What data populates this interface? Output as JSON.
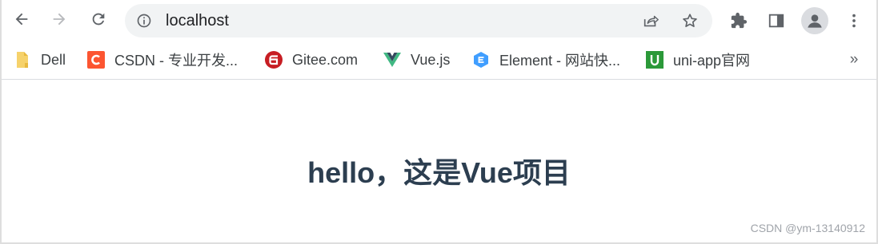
{
  "toolbar": {
    "url": "localhost",
    "icons": {
      "back": "arrow-left-icon",
      "forward": "arrow-right-icon",
      "reload": "reload-icon",
      "site_info": "info-circle-icon",
      "share": "share-icon",
      "bookmark_star": "star-icon",
      "extensions": "puzzle-icon",
      "side_panel": "side-panel-icon",
      "profile": "profile-icon",
      "menu": "kebab-menu-icon"
    }
  },
  "bookmarks": {
    "items": [
      {
        "label": "Dell",
        "icon": "folder-icon",
        "color": "#f6d26b"
      },
      {
        "label": "CSDN - 专业开发...",
        "icon": "csdn-icon",
        "color": "#fc5531"
      },
      {
        "label": "Gitee.com",
        "icon": "gitee-icon",
        "color": "#c71d23"
      },
      {
        "label": "Vue.js",
        "icon": "vue-icon",
        "color": "#41b883"
      },
      {
        "label": "Element - 网站快...",
        "icon": "element-icon",
        "color": "#409eff"
      },
      {
        "label": "uni-app官网",
        "icon": "uniapp-icon",
        "color": "#2b9939"
      }
    ],
    "more": "»"
  },
  "page": {
    "heading": "hello，这是Vue项目",
    "watermark": "CSDN @ym-13140912"
  }
}
